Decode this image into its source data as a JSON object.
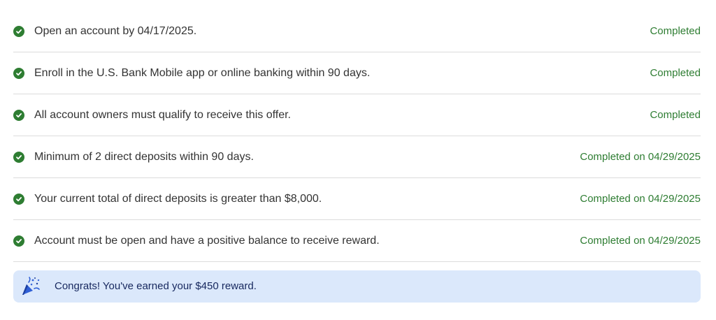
{
  "requirements": [
    {
      "text": "Open an account by 04/17/2025.",
      "status": "Completed"
    },
    {
      "text": "Enroll in the U.S. Bank Mobile app or online banking within 90 days.",
      "status": "Completed"
    },
    {
      "text": "All account owners must qualify to receive this offer.",
      "status": "Completed"
    },
    {
      "text": "Minimum of 2 direct deposits within 90 days.",
      "status": "Completed on 04/29/2025"
    },
    {
      "text": "Your current total of direct deposits is greater than $8,000.",
      "status": "Completed on 04/29/2025"
    },
    {
      "text": "Account must be open and have a positive balance to receive reward.",
      "status": "Completed on 04/29/2025"
    }
  ],
  "banner": {
    "icon": "party-popper-icon",
    "message": "Congrats! You've earned your $450 reward."
  },
  "colors": {
    "completed_green": "#2e7d32",
    "banner_background": "#dbe8fb",
    "banner_text": "#16275e",
    "divider": "#dcdcdc"
  }
}
